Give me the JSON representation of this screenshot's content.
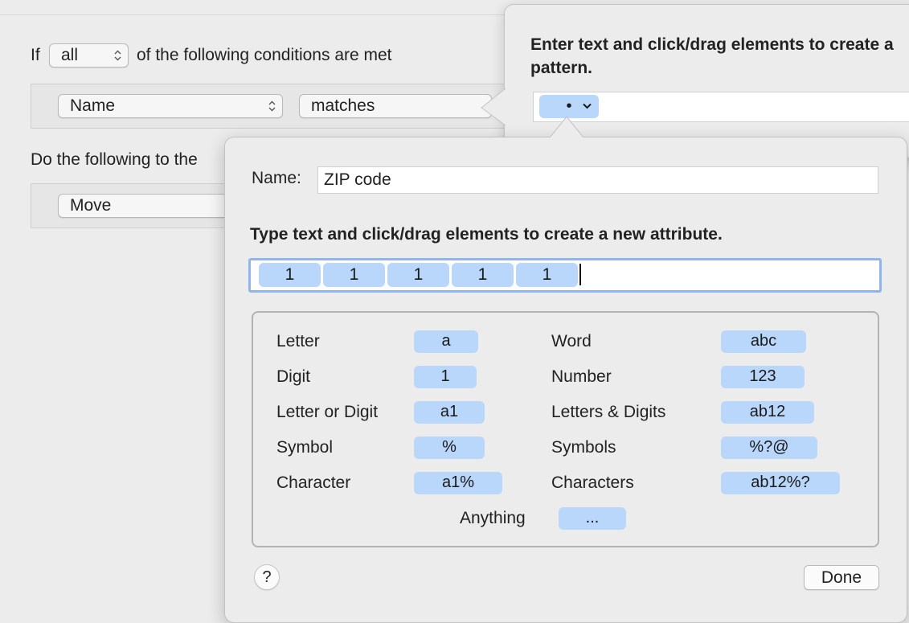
{
  "rule_editor": {
    "if_label": "If",
    "match_select": "all",
    "conditions_label": "of the following conditions are met",
    "condition_attribute": "Name",
    "condition_operator": "matches",
    "actions_label": "Do the following to the",
    "action_select": "Move"
  },
  "pattern_popover": {
    "title": "Enter text and click/drag elements to create a pattern.",
    "token_glyph": "•",
    "token_chevron": "chevron-down-icon"
  },
  "attribute_popover": {
    "name_label": "Name:",
    "name_value": "ZIP code",
    "instruction": "Type text and click/drag elements to create a new attribute.",
    "attribute_tokens": [
      "1",
      "1",
      "1",
      "1",
      "1"
    ],
    "elements": {
      "letter": {
        "label": "Letter",
        "token": "a"
      },
      "digit": {
        "label": "Digit",
        "token": "1"
      },
      "letter_or_digit": {
        "label": "Letter or Digit",
        "token": "a1"
      },
      "symbol": {
        "label": "Symbol",
        "token": "%"
      },
      "character": {
        "label": "Character",
        "token": "a1%"
      },
      "word": {
        "label": "Word",
        "token": "abc"
      },
      "number": {
        "label": "Number",
        "token": "123"
      },
      "letters_digits": {
        "label": "Letters & Digits",
        "token": "ab12"
      },
      "symbols": {
        "label": "Symbols",
        "token": "%?@"
      },
      "characters": {
        "label": "Characters",
        "token": "ab12%?"
      },
      "anything": {
        "label": "Anything",
        "token": "..."
      }
    },
    "help_label": "?",
    "done_label": "Done"
  },
  "colors": {
    "token_fill": "#b9d6fb",
    "focus_ring": "#8fb4f0",
    "window_bg": "#ececec"
  }
}
